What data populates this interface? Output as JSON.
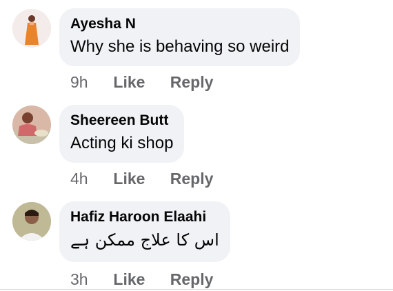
{
  "comments": [
    {
      "author": "Ayesha N",
      "text": "Why she is behaving so weird",
      "time": "9h",
      "like_label": "Like",
      "reply_label": "Reply"
    },
    {
      "author": "Sheereen Butt",
      "text": "Acting ki shop",
      "time": "4h",
      "like_label": "Like",
      "reply_label": "Reply"
    },
    {
      "author": "Hafiz Haroon Elaahi",
      "text": "اس کا علاج ممکن ہے",
      "time": "3h",
      "like_label": "Like",
      "reply_label": "Reply"
    }
  ],
  "colors": {
    "bubble": "#f0f2f5",
    "meta": "#65676b",
    "text": "#050505"
  }
}
